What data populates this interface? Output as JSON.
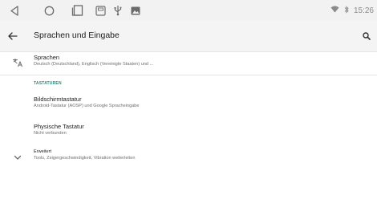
{
  "status_bar": {
    "time": "15:26"
  },
  "nav_buttons": [
    "back-triangle-icon",
    "home-circle-icon",
    "recents-square-icon",
    "sd-card-icon",
    "usb-icon",
    "image-icon"
  ],
  "app_bar": {
    "title": "Sprachen und Eingabe"
  },
  "items": {
    "languages": {
      "title": "Sprachen",
      "subtitle": "Deutsch (Deutschland), Englisch (Vereinigte Staaten) und ..."
    },
    "section_header": "TASTATUREN",
    "screen_keyboard": {
      "title": "Bildschirmtastatur",
      "subtitle": "Android-Tastatur (AOSP) und Google Spracheingabe"
    },
    "physical_keyboard": {
      "title": "Physische Tastatur",
      "subtitle": "Nicht verbunden"
    },
    "advanced": {
      "title": "Erweitert",
      "subtitle": "Tools, Zeigergeschwindigkeit, Vibration weiterleiten"
    }
  },
  "colors": {
    "accent": "#2a8a7e",
    "icon": "#6b6b6b"
  }
}
